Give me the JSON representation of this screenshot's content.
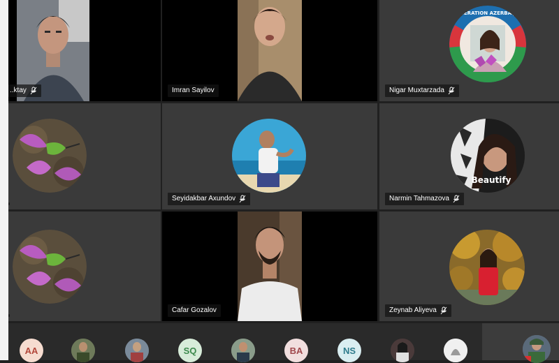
{
  "participants": [
    {
      "name": "..ktay",
      "muted": true
    },
    {
      "name": "Imran Sayilov",
      "muted": false
    },
    {
      "name": "Nigar Muxtarzada",
      "muted": true
    },
    {
      "name": "",
      "muted": false
    },
    {
      "name": "Seyidakbar Axundov",
      "muted": true
    },
    {
      "name": "Narmin Tahmazova",
      "muted": true
    },
    {
      "name": "",
      "muted": false
    },
    {
      "name": "Cafar Gozalov",
      "muted": false
    },
    {
      "name": "Zeynab Aliyeva",
      "muted": true
    }
  ],
  "avatar_badge_text": "Beautify",
  "seal_text": "GENERATION AZERBAIJAN",
  "bottom_strip": [
    {
      "initials": "AA",
      "bg": "#f6dcd0",
      "fg": "#b2463a"
    },
    {
      "initials": "",
      "bg": "#6e7a5a",
      "fg": "#fff"
    },
    {
      "initials": "",
      "bg": "#7a8a9a",
      "fg": "#fff"
    },
    {
      "initials": "SQ",
      "bg": "#d7ecd9",
      "fg": "#3d8a4d"
    },
    {
      "initials": "",
      "bg": "#8a9c8a",
      "fg": "#fff"
    },
    {
      "initials": "BA",
      "bg": "#f1dede",
      "fg": "#a0484c"
    },
    {
      "initials": "NS",
      "bg": "#d9eef1",
      "fg": "#2f7c8c"
    },
    {
      "initials": "",
      "bg": "#4a3a3a",
      "fg": "#fff"
    },
    {
      "initials": "",
      "bg": "#e0e0e0",
      "fg": "#333"
    }
  ],
  "colors": {
    "tile_bg": "#3a3a3a",
    "page_bg": "#202020",
    "tag_bg": "#141414"
  }
}
